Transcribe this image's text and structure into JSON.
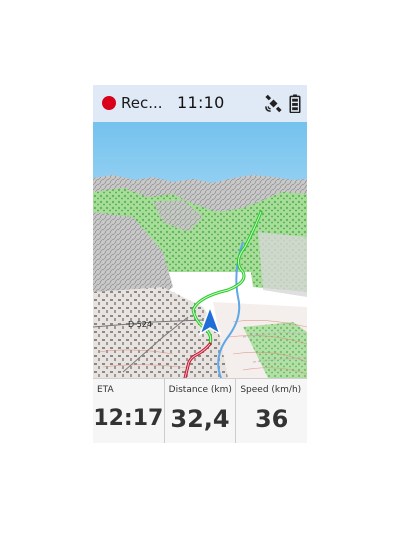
{
  "status_bar": {
    "recording_label": "Rec...",
    "time": "11:10",
    "recording_color": "#d9001b",
    "icons": [
      "recording-dot-icon",
      "gps-satellite-icon",
      "battery-icon"
    ]
  },
  "map": {
    "view": "3D terrain",
    "labels": {
      "road": "D 524"
    },
    "colors": {
      "sky": "#7fc8f0",
      "track_recorded": "#c8102e",
      "route_ahead": "#22cc22",
      "position_arrow": "#1f6fd6"
    }
  },
  "data_fields": [
    {
      "label": "ETA",
      "value": "12:17"
    },
    {
      "label": "Distance (km)",
      "value": "32,4"
    },
    {
      "label": "Speed (km/h)",
      "value": "36"
    }
  ]
}
